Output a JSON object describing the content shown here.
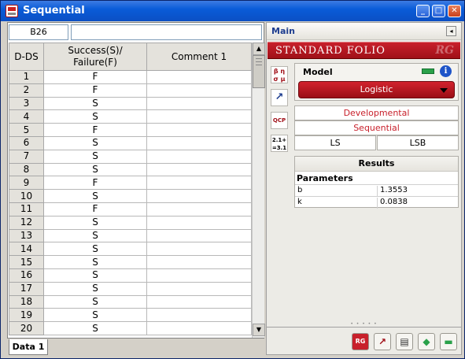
{
  "window": {
    "title": "Sequential",
    "buttons": {
      "minimize": "_",
      "maximize": "□",
      "close": "✕"
    }
  },
  "sheet": {
    "cell_ref": "B26",
    "formula_value": "",
    "columns": [
      "D-DS",
      "Success(S)/\nFailure(F)",
      "Comment 1"
    ],
    "rows": [
      [
        "1",
        "F",
        ""
      ],
      [
        "2",
        "F",
        ""
      ],
      [
        "3",
        "S",
        ""
      ],
      [
        "4",
        "S",
        ""
      ],
      [
        "5",
        "F",
        ""
      ],
      [
        "6",
        "S",
        ""
      ],
      [
        "7",
        "S",
        ""
      ],
      [
        "8",
        "S",
        ""
      ],
      [
        "9",
        "F",
        ""
      ],
      [
        "10",
        "S",
        ""
      ],
      [
        "11",
        "F",
        ""
      ],
      [
        "12",
        "S",
        ""
      ],
      [
        "13",
        "S",
        ""
      ],
      [
        "14",
        "S",
        ""
      ],
      [
        "15",
        "S",
        ""
      ],
      [
        "16",
        "S",
        ""
      ],
      [
        "17",
        "S",
        ""
      ],
      [
        "18",
        "S",
        ""
      ],
      [
        "19",
        "S",
        ""
      ],
      [
        "20",
        "S",
        ""
      ]
    ],
    "scroll": {
      "up": "▲",
      "down": "▼"
    },
    "tabs": [
      "Data 1"
    ]
  },
  "panel": {
    "title": "Main",
    "collapse": "◂",
    "banner": "STANDARD FOLIO",
    "banner_logo": "RG",
    "model_label": "Model",
    "model_value": "Logistic",
    "info_glyph": "i",
    "options": {
      "developmental": "Developmental",
      "sequential": "Sequential",
      "ls": "LS",
      "lsb": "LSB"
    },
    "results": {
      "title": "Results",
      "params_label": "Parameters",
      "params": [
        {
          "name": "b",
          "value": "1.3553"
        },
        {
          "name": "k",
          "value": "0.0838"
        }
      ]
    },
    "side_icons": [
      "β η\nσ μ",
      "↗",
      "QCP",
      "2.1+\n=3.1"
    ],
    "toolbar_icons": [
      "RG",
      "↗",
      "▤",
      "◆",
      "▬"
    ],
    "splitter": "• • • • •"
  },
  "colors": {
    "accent_red": "#c8202b",
    "title_blue": "#0a5cd8",
    "panel_header_text": "#1e3d8f"
  }
}
